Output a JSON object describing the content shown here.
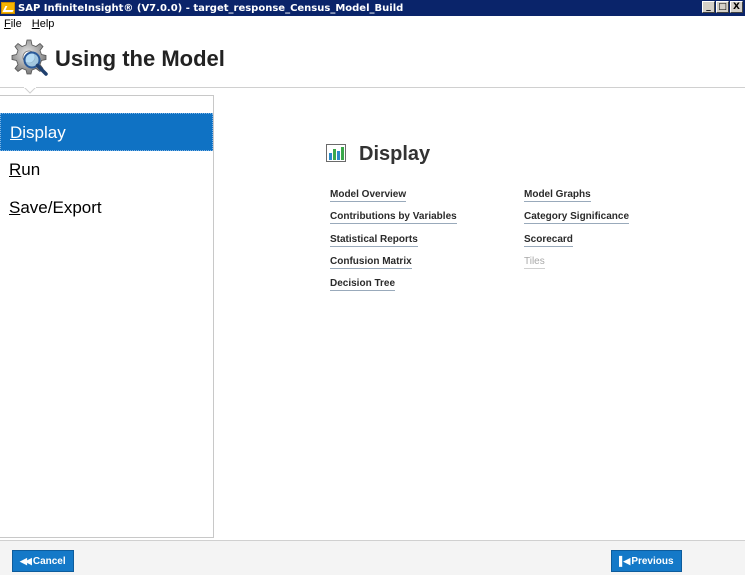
{
  "window": {
    "title": "SAP InfiniteInsight® (V7.0.0) - target_response_Census_Model_Build",
    "min_label": "_",
    "max_label": "□",
    "close_label": "X"
  },
  "menu": [
    {
      "key": "F",
      "rest": "ile"
    },
    {
      "key": "H",
      "rest": "elp"
    }
  ],
  "header": {
    "title": "Using the Model",
    "icon": "gear-magnifier-icon"
  },
  "sidebar": {
    "items": [
      {
        "key": "D",
        "rest": "isplay",
        "active": true
      },
      {
        "key": "R",
        "rest": "un",
        "active": false
      },
      {
        "key": "S",
        "rest": "ave/Export",
        "active": false
      }
    ]
  },
  "main": {
    "section_title": "Display",
    "section_icon": "bar-chart-icon",
    "links_left": [
      {
        "label": "Model Overview",
        "enabled": true
      },
      {
        "label": "Contributions by Variables",
        "enabled": true
      },
      {
        "label": "Statistical Reports",
        "enabled": true
      },
      {
        "label": "Confusion Matrix",
        "enabled": true
      },
      {
        "label": "Decision Tree",
        "enabled": true
      }
    ],
    "links_right": [
      {
        "label": "Model Graphs",
        "enabled": true
      },
      {
        "label": "Category Significance",
        "enabled": true
      },
      {
        "label": "Scorecard",
        "enabled": true
      },
      {
        "label": "Tiles",
        "enabled": false
      }
    ]
  },
  "footer": {
    "cancel_label": "Cancel",
    "previous_label": "Previous"
  },
  "colors": {
    "titlebar": "#0a246a",
    "accent": "#0f72c4",
    "button": "#1479c8"
  }
}
